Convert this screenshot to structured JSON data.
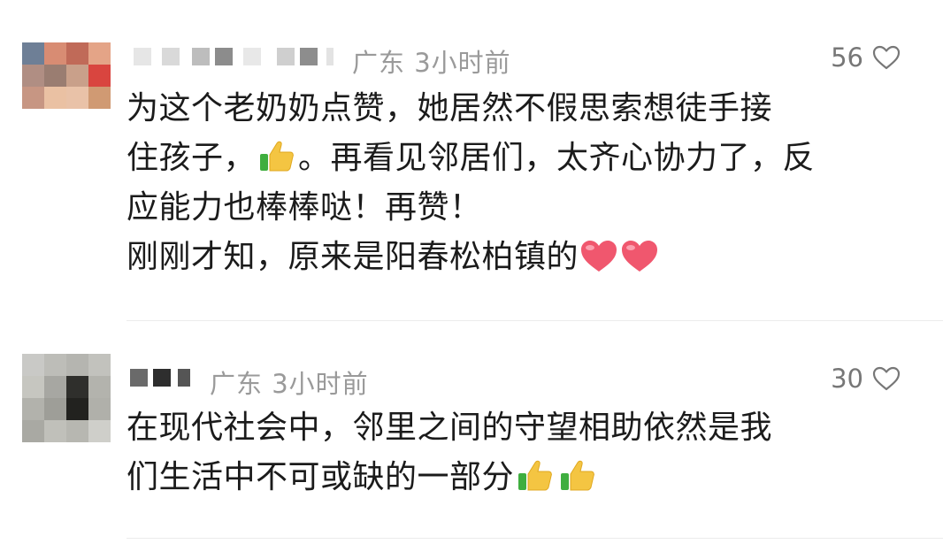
{
  "comments": [
    {
      "location": "广东",
      "time": "3小时前",
      "likes": "56",
      "lines": [
        "为这个老奶奶点赞，她居然不假思索想徒手接",
        "住孩子，",
        "。再看见邻居们，太齐心协力了，反",
        "应能力也棒棒哒！再赞！",
        "刚刚才知，原来是阳春松柏镇的"
      ],
      "icons": [
        "thumbs-up-emoji",
        "red-heart-emoji"
      ]
    },
    {
      "location": "广东",
      "time": "3小时前",
      "likes": "30",
      "lines": [
        "在现代社会中，邻里之间的守望相助依然是我",
        "们生活中不可或缺的一部分"
      ],
      "icons": [
        "thumbs-up-emoji"
      ]
    }
  ]
}
